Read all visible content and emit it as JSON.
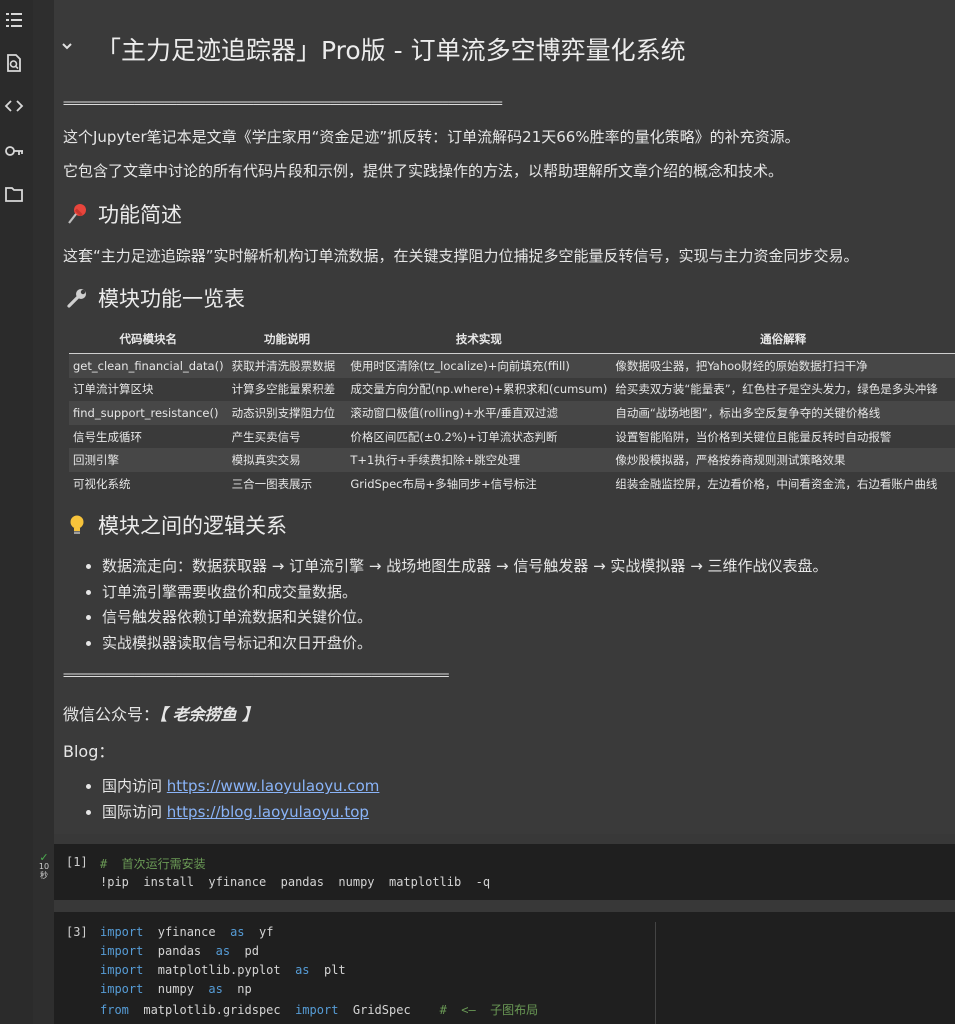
{
  "sidebar": {
    "icons": [
      "list-icon",
      "search-doc-icon",
      "code-brackets-icon",
      "key-icon",
      "folder-icon"
    ]
  },
  "markdown": {
    "title": "「主力足迹追踪器」Pro版 - 订单流多空博弈量化系统",
    "equals_line_1": "==========================================================================",
    "intro_1": "这个Jupyter笔记本是文章《学庄家用“资金足迹”抓反转：订单流解码21天66%胜率的量化策略》的补充资源。",
    "intro_2": "它包含了文章中讨论的所有代码片段和示例，提供了实践操作的方法，以帮助理解所文章介绍的概念和技术。",
    "section_overview": "功能简述",
    "overview_text": "这套“主力足迹追踪器”实时解析机构订单流数据，在关键支撑阻力位捕捉多空能量反转信号，实现与主力资金同步交易。",
    "section_modules": "模块功能一览表",
    "table": {
      "headers": [
        "代码模块名",
        "功能说明",
        "技术实现",
        "通俗解释"
      ],
      "rows": [
        [
          "get_clean_financial_data()",
          "获取并清洗股票数据",
          "使用时区清除(tz_localize)+向前填充(ffill)",
          "像数据吸尘器，把Yahoo财经的原始数据打扫干净"
        ],
        [
          "订单流计算区块",
          "计算多空能量累积差",
          "成交量方向分配(np.where)+累积求和(cumsum)",
          "给买卖双方装“能量表”，红色柱子是空头发力，绿色是多头冲锋"
        ],
        [
          "find_support_resistance()",
          "动态识别支撑阻力位",
          "滚动窗口极值(rolling)+水平/垂直双过滤",
          "自动画“战场地图”，标出多空反复争夺的关键价格线"
        ],
        [
          "信号生成循环",
          "产生买卖信号",
          "价格区间匹配(±0.2%)+订单流状态判断",
          "设置智能陷阱，当价格到关键位且能量反转时自动报警"
        ],
        [
          "回测引擎",
          "模拟真实交易",
          "T+1执行+手续费扣除+跳空处理",
          "像炒股模拟器，严格按券商规则测试策略效果"
        ],
        [
          "可视化系统",
          "三合一图表展示",
          "GridSpec布局+多轴同步+信号标注",
          "组装金融监控屏，左边看价格，中间看资金流，右边看账户曲线"
        ]
      ]
    },
    "section_logic": "模块之间的逻辑关系",
    "logic_items": [
      "数据流走向：数据获取器 → 订单流引擎 → 战场地图生成器 → 信号触发器 → 实战模拟器 → 三维作战仪表盘。",
      "订单流引擎需要收盘价和成交量数据。",
      "信号触发器依赖订单流数据和关键价位。",
      "实战模拟器读取信号标记和次日开盘价。"
    ],
    "equals_line_2": "=================================================================",
    "wechat_label": "微信公众号：",
    "wechat_name": "【 老余捞鱼 】",
    "blog_label": "Blog：",
    "blog_links": [
      {
        "prefix": "国内访问 ",
        "url": "https://www.laoyulaoyu.com"
      },
      {
        "prefix": "国际访问 ",
        "url": "https://blog.laoyulaoyu.top"
      }
    ]
  },
  "cell1": {
    "exec_count": "[1]",
    "status_check": "✓",
    "status_time": "10",
    "status_unit": "秒",
    "comment": "#  首次运行需安装",
    "command": "!pip  install  yfinance  pandas  numpy  matplotlib  -q"
  },
  "cell2": {
    "exec_count": "[3]",
    "lines": [
      {
        "kw1": "import",
        "mod": "  yfinance  ",
        "kw2": "as",
        "alias": "  yf"
      },
      {
        "kw1": "import",
        "mod": "  pandas  ",
        "kw2": "as",
        "alias": "  pd"
      },
      {
        "kw1": "import",
        "mod": "  matplotlib.pyplot  ",
        "kw2": "as",
        "alias": "  plt"
      },
      {
        "kw1": "import",
        "mod": "  numpy  ",
        "kw2": "as",
        "alias": "  np"
      }
    ],
    "from_kw": "from",
    "from_mod": "  matplotlib.gridspec  ",
    "from_import": "import",
    "from_name": "  GridSpec    ",
    "from_comment": "#  <—  子图布局"
  }
}
